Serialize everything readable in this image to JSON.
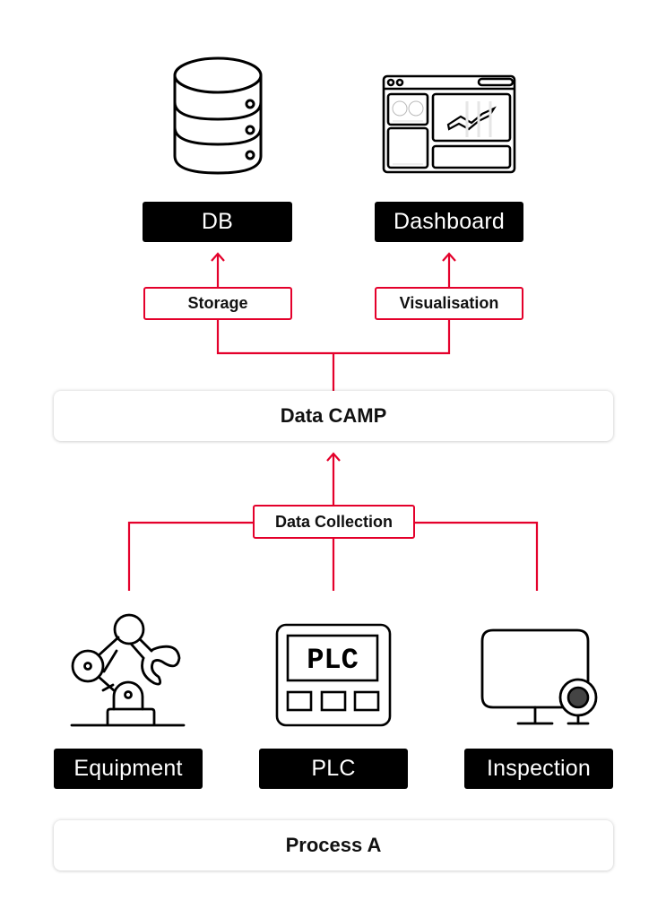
{
  "outputs": {
    "db": {
      "label": "DB",
      "icon": "database-icon"
    },
    "dashboard": {
      "label": "Dashboard",
      "icon": "dashboard-icon"
    }
  },
  "flows": {
    "storage": "Storage",
    "visualisation": "Visualisation",
    "data_collection": "Data Collection"
  },
  "hub": {
    "label": "Data CAMP"
  },
  "sources": [
    {
      "label": "Equipment",
      "icon": "robot-arm-icon"
    },
    {
      "label": "PLC",
      "icon": "plc-icon",
      "screen_text": "PLC"
    },
    {
      "label": "Inspection",
      "icon": "monitor-camera-icon"
    }
  ],
  "process": {
    "label": "Process A"
  },
  "colors": {
    "accent": "#e4002b",
    "label_bg": "#000000",
    "panel_bg": "#ffffff"
  }
}
